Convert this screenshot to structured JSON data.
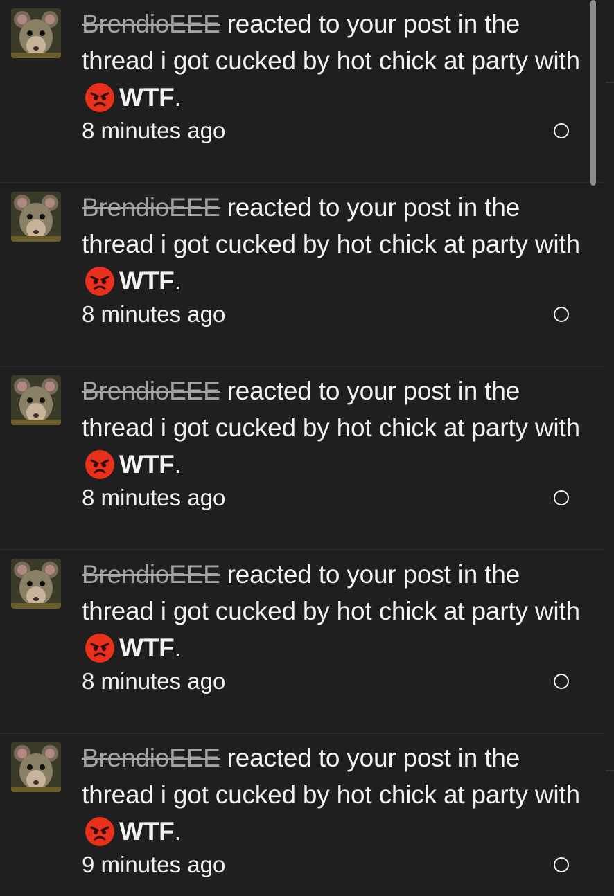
{
  "notifications": [
    {
      "username": "BrendioEEE",
      "message_middle": " reacted to your post in the thread i got cucked by hot chick at party with ",
      "reaction": "WTF",
      "trailing": ".",
      "time": "8 minutes ago",
      "reaction_icon": "angry-face-icon"
    },
    {
      "username": "BrendioEEE",
      "message_middle": " reacted to your post in the thread i got cucked by hot chick at party with ",
      "reaction": "WTF",
      "trailing": ".",
      "time": "8 minutes ago",
      "reaction_icon": "angry-face-icon"
    },
    {
      "username": "BrendioEEE",
      "message_middle": " reacted to your post in the thread i got cucked by hot chick at party with ",
      "reaction": "WTF",
      "trailing": ".",
      "time": "8 minutes ago",
      "reaction_icon": "angry-face-icon"
    },
    {
      "username": "BrendioEEE",
      "message_middle": " reacted to your post in the thread i got cucked by hot chick at party with ",
      "reaction": "WTF",
      "trailing": ".",
      "time": "8 minutes ago",
      "reaction_icon": "angry-face-icon"
    },
    {
      "username": "BrendioEEE",
      "message_middle": " reacted to your post in the thread i got cucked by hot chick at party with ",
      "reaction": "WTF",
      "trailing": ".",
      "time": "9 minutes ago",
      "reaction_icon": "angry-face-icon"
    }
  ],
  "colors": {
    "background": "#1f1f20",
    "text": "#f2f2f2",
    "username": "#a3a3a3",
    "reaction_red": "#e8301c",
    "divider": "#2b2b2c"
  }
}
